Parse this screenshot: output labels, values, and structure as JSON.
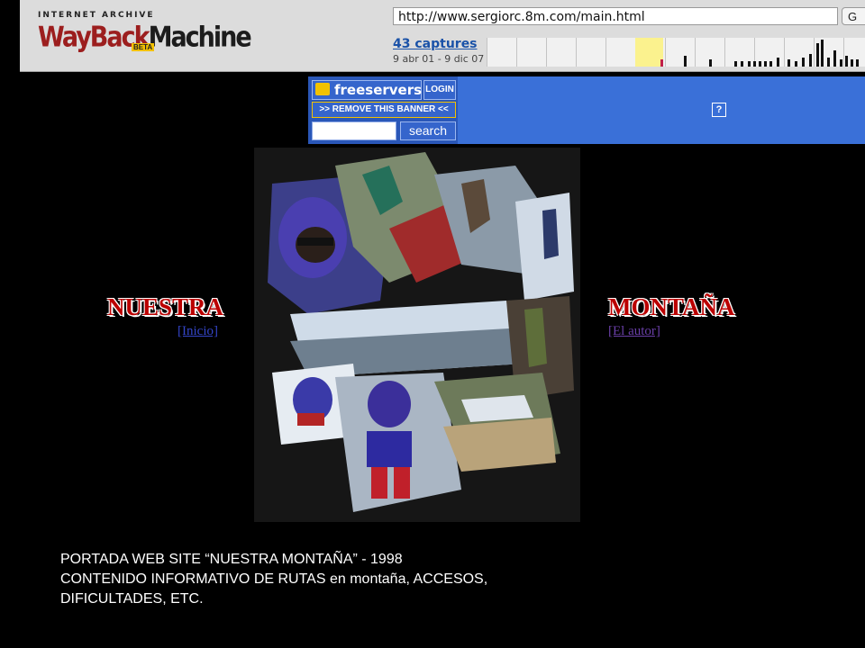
{
  "wayback": {
    "logo_top": "INTERNET ARCHIVE",
    "logo_main_a": "WayBack",
    "logo_main_b": "Machine",
    "logo_beta": "BETA",
    "url": "http://www.sergiorc.8m.com/main.html",
    "go_label": "G",
    "captures": "43 captures",
    "range": "9 abr 01 - 9 dic 07"
  },
  "banner": {
    "brand": "freeservers",
    "login": "LOGIN",
    "remove": ">> REMOVE THIS BANNER <<",
    "search_input_value": "",
    "search_button": "search",
    "help": "?"
  },
  "page": {
    "title_left": "NUESTRA",
    "title_right": "MONTAÑA",
    "link_left": "[Inicio]",
    "link_right": "[El autor]",
    "collage_alt": "mountaineering collage"
  },
  "caption": {
    "line1": "PORTADA WEB SITE “NUESTRA MONTAÑA” - 1998",
    "line2": "CONTENIDO INFORMATIVO DE RUTAS en montaña, ACCESOS,",
    "line3": "DIFICULTADES, ETC."
  },
  "colors": {
    "background": "#000000",
    "title_red": "#bb0000",
    "link_blue": "#3445c8",
    "banner_blue": "#3a70d8"
  }
}
